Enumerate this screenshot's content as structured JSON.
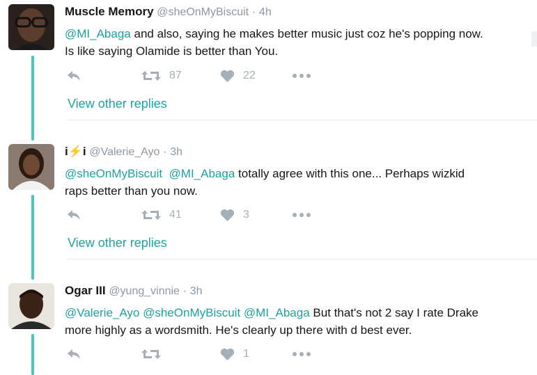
{
  "colors": {
    "thread_line": "#45c7b9",
    "mention": "#1da1a1",
    "muted": "#8b98a5",
    "action_icon": "#a5afb8"
  },
  "tweets": [
    {
      "name": "Muscle Memory",
      "handle": "@sheOnMyBiscuit",
      "dot": "·",
      "time": "4h",
      "line1": [
        {
          "text": "@MI_Abaga",
          "mention": true
        },
        {
          "text": " and also, saying he makes better music just coz he's popping now.",
          "mention": false
        }
      ],
      "line2": [
        {
          "text": "Is like saying Olamide is better than You.",
          "mention": false
        }
      ],
      "retweets": "87",
      "likes": "22",
      "view_replies": "View other replies"
    },
    {
      "name": "i⚡i",
      "handle": "@Valerie_Ayo",
      "dot": "·",
      "time": "3h",
      "line1": [
        {
          "text": "@sheOnMyBiscuit",
          "mention": true
        },
        {
          "text": "  ",
          "mention": false
        },
        {
          "text": "@MI_Abaga",
          "mention": true
        },
        {
          "text": " totally agree with this one... Perhaps wizkid",
          "mention": false
        }
      ],
      "line2": [
        {
          "text": "raps better than you now.",
          "mention": false
        }
      ],
      "retweets": "41",
      "likes": "3",
      "view_replies": "View other replies"
    },
    {
      "name": "Ogar III",
      "handle": "@yung_vinnie",
      "dot": "·",
      "time": "3h",
      "line1": [
        {
          "text": "@Valerie_Ayo",
          "mention": true
        },
        {
          "text": " ",
          "mention": false
        },
        {
          "text": "@sheOnMyBiscuit",
          "mention": true
        },
        {
          "text": " ",
          "mention": false
        },
        {
          "text": "@MI_Abaga",
          "mention": true
        },
        {
          "text": " But that's not 2 say I rate Drake",
          "mention": false
        }
      ],
      "line2": [
        {
          "text": "more highly as a wordsmith. He's clearly up there with d best ever.",
          "mention": false
        }
      ],
      "retweets": "",
      "likes": "1"
    }
  ]
}
